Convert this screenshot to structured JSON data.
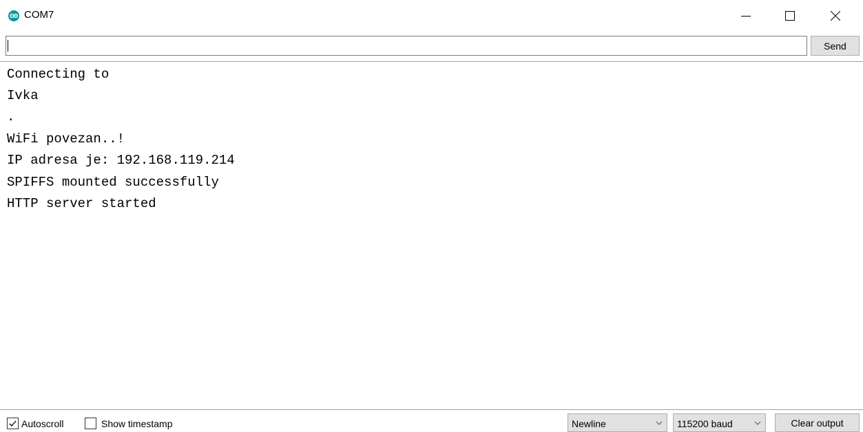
{
  "window": {
    "title": "COM7",
    "icon": "arduino-icon",
    "controls": [
      "minimize-icon",
      "maximize-icon",
      "close-icon"
    ]
  },
  "input": {
    "value": "",
    "send_label": "Send"
  },
  "output": {
    "lines": [
      "Connecting to",
      "Ivka",
      ".",
      "WiFi povezan..!",
      "IP adresa je: 192.168.119.214",
      "SPIFFS mounted successfully",
      "HTTP server started"
    ]
  },
  "footer": {
    "autoscroll": {
      "label": "Autoscroll",
      "checked": true
    },
    "show_timestamp": {
      "label": "Show timestamp",
      "checked": false
    },
    "line_ending": {
      "selected": "Newline"
    },
    "baud_rate": {
      "selected": "115200 baud"
    },
    "clear_label": "Clear output"
  },
  "colors": {
    "accent": "#00979c",
    "button_bg": "#e1e1e1"
  }
}
